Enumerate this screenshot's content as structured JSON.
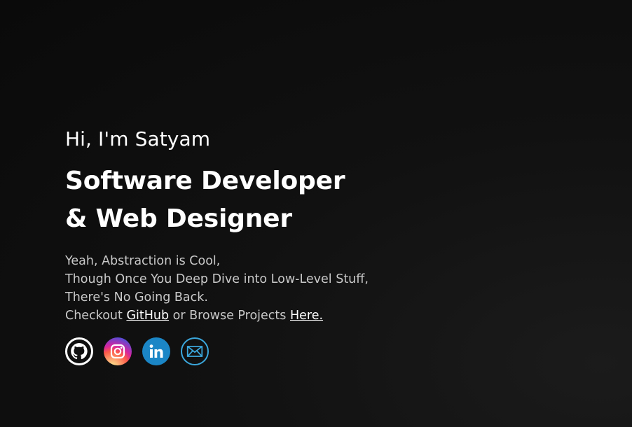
{
  "hero": {
    "greeting": "Hi, I'm Satyam",
    "headline_line1": "Software Developer",
    "headline_line2": "& Web Designer",
    "bio_line1": "Yeah, Abstraction is Cool,",
    "bio_line2": "Though Once You Deep Dive into Low-Level Stuff,",
    "bio_line3": "There's No Going Back.",
    "bio_prefix": "Checkout ",
    "github_link": "GitHub",
    "bio_middle": " or Browse Projects ",
    "projects_link": "Here."
  },
  "socials": [
    {
      "name": "github-icon"
    },
    {
      "name": "instagram-icon"
    },
    {
      "name": "linkedin-icon"
    },
    {
      "name": "mail-icon"
    }
  ],
  "colors": {
    "background": "#0e0e0e",
    "text": "#ffffff",
    "muted_text": "#c9c9c9",
    "linkedin_blue": "#1b86c6",
    "mail_blue": "#3ba7dc"
  }
}
